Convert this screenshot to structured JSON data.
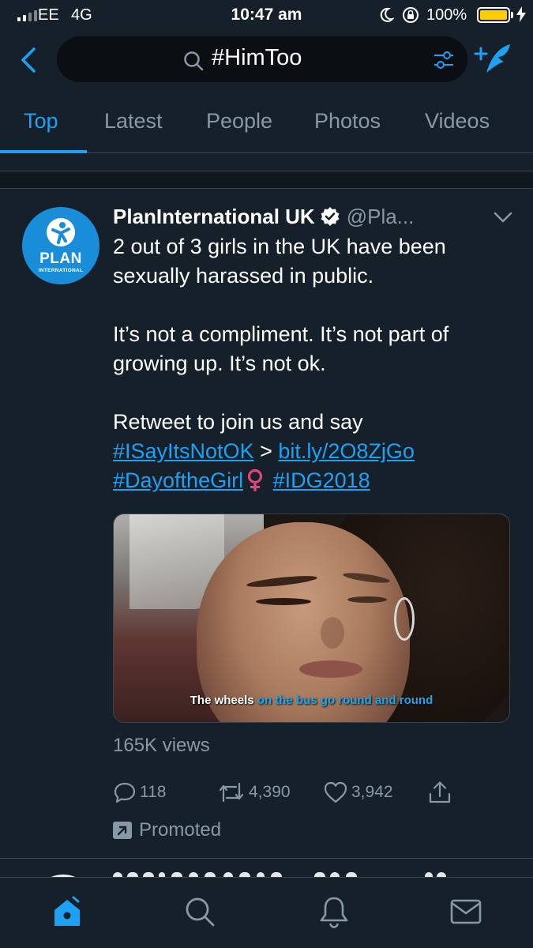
{
  "status_bar": {
    "carrier": "EE",
    "network": "4G",
    "time": "10:47 am",
    "battery_percent": "100%"
  },
  "search": {
    "query": "#HimToo"
  },
  "tabs": [
    {
      "label": "Top",
      "active": true
    },
    {
      "label": "Latest",
      "active": false
    },
    {
      "label": "People",
      "active": false
    },
    {
      "label": "Photos",
      "active": false
    },
    {
      "label": "Videos",
      "active": false
    }
  ],
  "tweet": {
    "author_name": "PlanInternational UK",
    "author_handle": "@Pla...",
    "avatar": {
      "word": "PLAN",
      "subword": "INTERNATIONAL"
    },
    "text_line1": "2 out of 3 girls in the UK have been",
    "text_line2": "sexually harassed in public.",
    "text_line3": "It’s not a compliment. It’s not part of",
    "text_line4": "growing up. It’s not ok.",
    "text_line5": "Retweet to join us and say",
    "hashtag_1": "#ISayItsNotOK",
    "arrow": ">",
    "link_url": "bit.ly/2O8ZjGo",
    "hashtag_2": "#DayoftheGirl",
    "hashtag_3": "#IDG2018",
    "video_caption_white": "The wheels",
    "video_caption_blue": "on the bus go round and round",
    "views": "165K views",
    "replies": "118",
    "retweets": "4,390",
    "likes": "3,942",
    "promoted_label": "Promoted"
  },
  "colors": {
    "background": "#15202b",
    "accent": "#1da1f2",
    "secondary_text": "#8899a6",
    "divider": "#38444d",
    "avatar_blue": "#1a8dd8",
    "female_sign": "#e0457b"
  },
  "icons": {
    "back": "chevron-left-icon",
    "search": "search-icon",
    "filter": "filter-icon",
    "compose": "compose-feather-icon",
    "verified": "verified-badge-icon",
    "caret": "chevron-down-icon",
    "reply": "reply-icon",
    "retweet": "retweet-icon",
    "like": "heart-icon",
    "share": "share-icon",
    "promoted": "promoted-icon",
    "home": "home-icon",
    "explore": "search-icon",
    "notifications": "bell-icon",
    "messages": "mail-icon"
  }
}
